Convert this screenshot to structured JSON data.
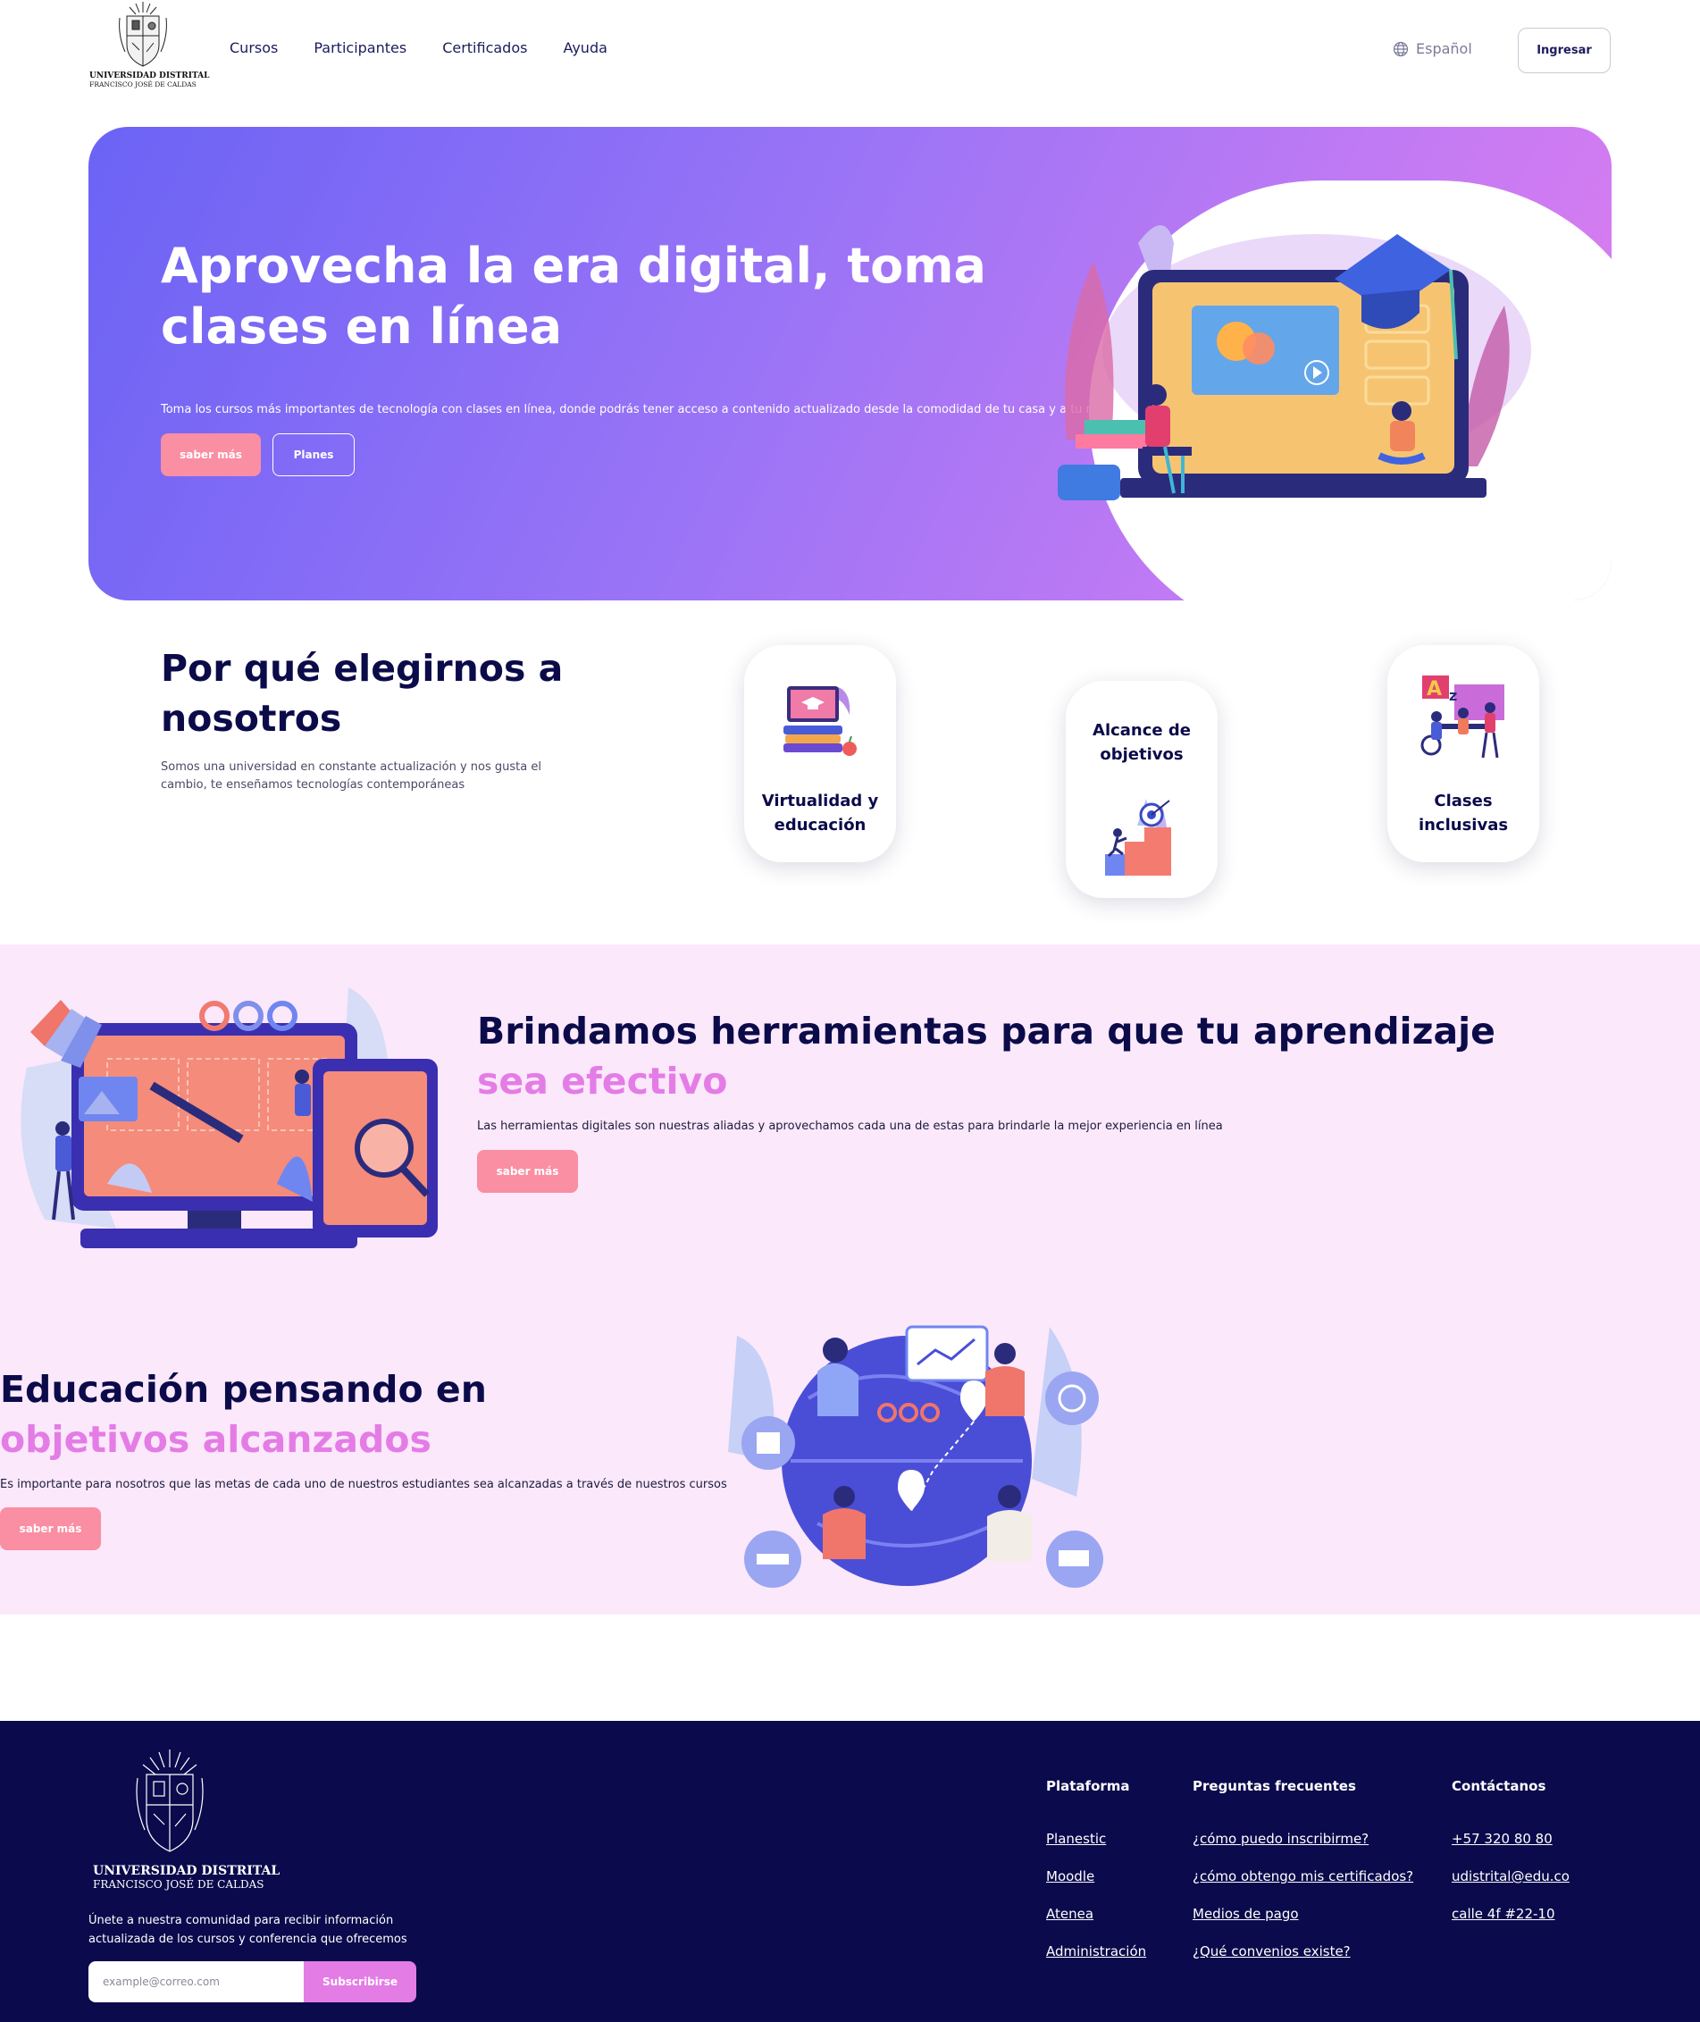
{
  "brand": {
    "logo_line1": "UNIVERSIDAD DISTRITAL",
    "logo_line2": "FRANCISCO JOSÉ DE CALDAS"
  },
  "nav": {
    "links": [
      "Cursos",
      "Participantes",
      "Certificados",
      "Ayuda"
    ],
    "language": "Español",
    "login_label": "Ingresar"
  },
  "hero": {
    "title": "Aprovecha la era digital, toma clases en línea",
    "subtitle": "Toma los cursos más importantes de tecnología con clases en línea, donde podrás tener acceso a contenido actualizado desde la comodidad de tu casa y a tu ritmo",
    "primary_button": "saber más",
    "secondary_button": "Planes"
  },
  "why": {
    "title": "Por qué elegirnos a nosotros",
    "subtitle": "Somos una universidad en constante actualización y nos gusta el cambio, te enseñamos tecnologías contemporáneas",
    "cards": [
      {
        "label": "Virtualidad y educación",
        "icon": "online-education-icon"
      },
      {
        "label": "Alcance de objetivos",
        "icon": "goal-reach-icon"
      },
      {
        "label": "Clases inclusivas",
        "icon": "inclusive-class-icon"
      }
    ]
  },
  "tools": {
    "title_line1": "Brindamos herramientas para que tu aprendizaje",
    "title_line2": "sea efectivo",
    "text": "Las herramientas digitales son nuestras aliadas y aprovechamos cada una de estas para brindarle la mejor experiencia en línea",
    "button": "saber más"
  },
  "goals": {
    "title_line1": "Educación pensando en",
    "title_line2": "objetivos alcanzados",
    "text": "Es importante para nosotros que las metas de cada uno de nuestros estudiantes sea alcanzadas a través de nuestros cursos",
    "button": "saber más"
  },
  "footer": {
    "newsletter_text": "Únete a nuestra comunidad para recibir información actualizada de los cursos y conferencia que ofrecemos",
    "email_placeholder": "example@correo.com",
    "subscribe_button": "Subscribirse",
    "columns": [
      {
        "title": "Plataforma",
        "links": [
          "Planestic",
          "Moodle",
          "Atenea",
          "Administración"
        ]
      },
      {
        "title": "Preguntas frecuentes",
        "links": [
          "¿cómo puedo inscribirme?",
          "¿cómo obtengo mis certificados?",
          "Medios de pago",
          "¿Qué convenios existe?"
        ]
      },
      {
        "title": "Contáctanos",
        "links": [
          "+57 320 80 80",
          "udistrital@edu.co",
          "calle 4f #22-10"
        ]
      }
    ]
  },
  "colors": {
    "primary_dark": "#0b0b4a",
    "accent_pink": "#fa8ea3",
    "accent_magenta": "#e47ce6",
    "section_bg": "#fbe8fb",
    "footer_bg": "#0a0a4c"
  }
}
